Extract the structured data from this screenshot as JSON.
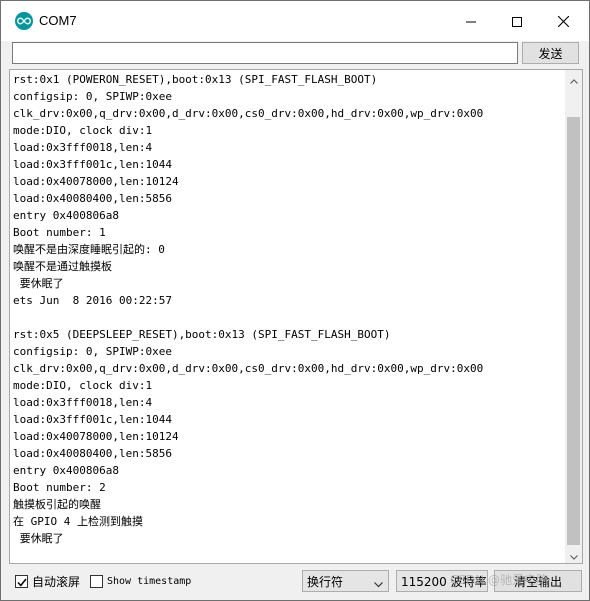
{
  "window": {
    "title": "COM7"
  },
  "input": {
    "value": "",
    "placeholder": ""
  },
  "toolbar": {
    "send_label": "发送"
  },
  "log_lines": [
    "rst:0x1 (POWERON_RESET),boot:0x13 (SPI_FAST_FLASH_BOOT)",
    "configsip: 0, SPIWP:0xee",
    "clk_drv:0x00,q_drv:0x00,d_drv:0x00,cs0_drv:0x00,hd_drv:0x00,wp_drv:0x00",
    "mode:DIO, clock div:1",
    "load:0x3fff0018,len:4",
    "load:0x3fff001c,len:1044",
    "load:0x40078000,len:10124",
    "load:0x40080400,len:5856",
    "entry 0x400806a8",
    "Boot number: 1",
    "唤醒不是由深度睡眠引起的: 0",
    "唤醒不是通过触摸板",
    " 要休眠了",
    "ets Jun  8 2016 00:22:57",
    "",
    "rst:0x5 (DEEPSLEEP_RESET),boot:0x13 (SPI_FAST_FLASH_BOOT)",
    "configsip: 0, SPIWP:0xee",
    "clk_drv:0x00,q_drv:0x00,d_drv:0x00,cs0_drv:0x00,hd_drv:0x00,wp_drv:0x00",
    "mode:DIO, clock div:1",
    "load:0x3fff0018,len:4",
    "load:0x3fff001c,len:1044",
    "load:0x40078000,len:10124",
    "load:0x40080400,len:5856",
    "entry 0x400806a8",
    "Boot number: 2",
    "触摸板引起的唤醒",
    "在 GPIO 4 上检测到触摸",
    " 要休眠了"
  ],
  "bottom": {
    "autoscroll_label": "自动滚屏",
    "autoscroll_checked": true,
    "timestamp_label": "Show timestamp",
    "timestamp_checked": false,
    "line_ending_value": "换行符",
    "baud_value": "115200 波特率",
    "clear_label": "清空输出"
  },
  "watermark": "CSDN @驰爱电脑",
  "colors": {
    "app_icon": "#00979c",
    "scroll_thumb": "#c1c1c1"
  },
  "icons": {
    "app": "arduino-icon",
    "minimize": "minimize-icon",
    "maximize": "maximize-icon",
    "close": "close-icon",
    "scroll_up": "chevron-up-icon",
    "scroll_down": "chevron-down-icon",
    "dropdown": "chevron-down-icon",
    "check": "check-icon"
  }
}
